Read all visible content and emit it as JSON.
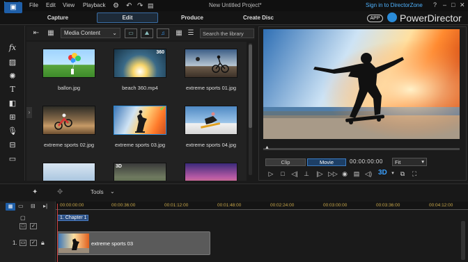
{
  "titlebar": {
    "menus": [
      "File",
      "Edit",
      "View",
      "Playback"
    ],
    "project_title": "New Untitled Project*",
    "signin": "Sign in to DirectorZone",
    "help": "?",
    "minimize": "–",
    "maximize": "□",
    "close": "✕"
  },
  "tabs": [
    "Capture",
    "Edit",
    "Produce",
    "Create Disc"
  ],
  "brand": {
    "app_badge": "APP",
    "name": "PowerDirector"
  },
  "library": {
    "content_dropdown": "Media Content",
    "search_placeholder": "Search the library",
    "items": [
      {
        "label": "ballon.jpg",
        "badge": ""
      },
      {
        "label": "beach 360.mp4",
        "badge": "360"
      },
      {
        "label": "extreme sports 01.jpg",
        "badge": ""
      },
      {
        "label": "extreme sports 02.jpg",
        "badge": ""
      },
      {
        "label": "extreme sports 03.jpg",
        "badge": "✔"
      },
      {
        "label": "extreme sports 04.jpg",
        "badge": ""
      },
      {
        "label": "",
        "badge": ""
      },
      {
        "label": "",
        "badge": "3D"
      },
      {
        "label": "",
        "badge": ""
      }
    ]
  },
  "preview": {
    "clip_label": "Clip",
    "movie_label": "Movie",
    "timecode": "00:00:00:00",
    "fit_dropdown": "Fit",
    "threed": "3D"
  },
  "timeline": {
    "tools_label": "Tools",
    "ruler_ticks": [
      "00:00:00:00",
      "00:00:36:00",
      "00:01:12:00",
      "00:01:48:00",
      "00:02:24:00",
      "00:03:00:00",
      "00:03:36:00",
      "00:04:12:00"
    ],
    "chapter_label": "1. Chapter 1",
    "track_number": "1.",
    "clip_name": "extreme sports 03"
  },
  "colors": {
    "accent": "#2a8bd8",
    "timecode_ticks": "#c9a84a",
    "signin": "#4fb3ff"
  }
}
